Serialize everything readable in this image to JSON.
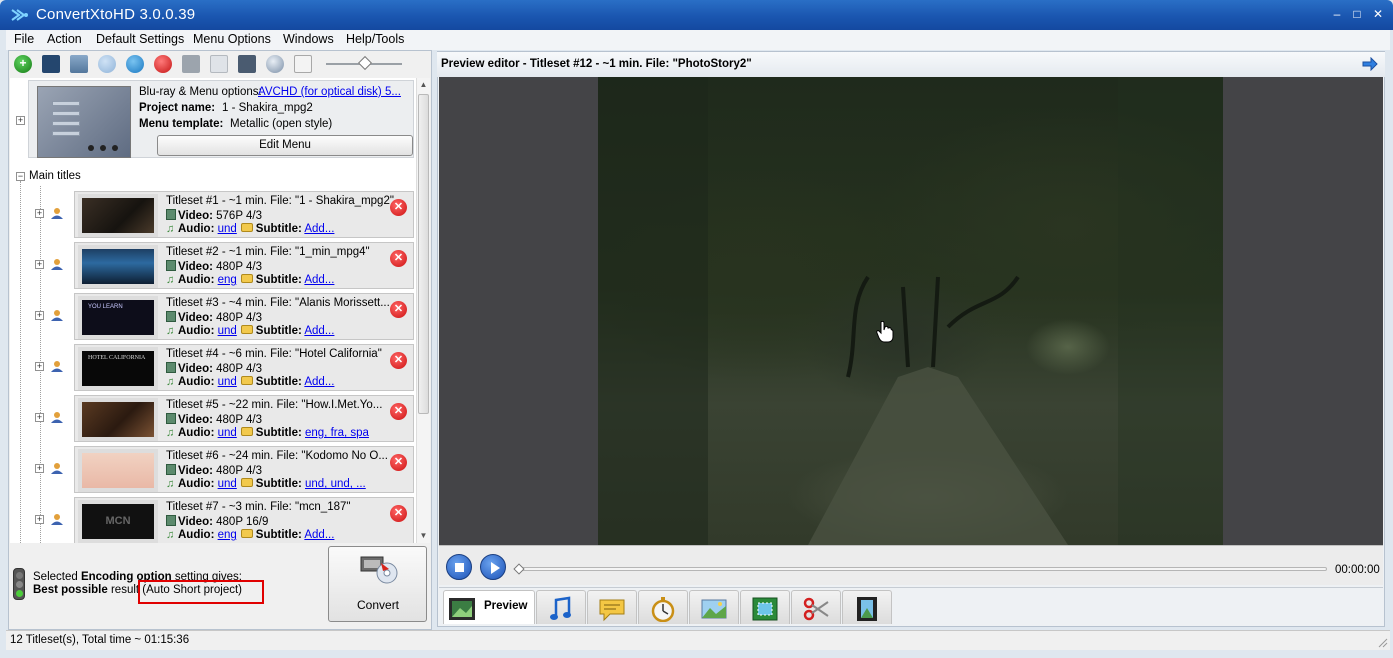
{
  "window": {
    "title": "ConvertXtoHD 3.0.0.39"
  },
  "menu": [
    "File",
    "Action",
    "Default Settings",
    "Menu Options",
    "Windows",
    "Help/Tools"
  ],
  "project": {
    "bluray_label": "Blu-ray & Menu options:",
    "bluray_value": "AVCHD (for optical disk) 5...",
    "name_label": "Project name:",
    "name_value": "1 - Shakira_mpg2",
    "template_label": "Menu template:",
    "template_value": "Metallic (open style)",
    "edit_menu": "Edit Menu"
  },
  "tree": {
    "main_titles": "Main titles"
  },
  "labels": {
    "video": "Video:",
    "audio": "Audio:",
    "subtitle": "Subtitle:"
  },
  "titlesets": [
    {
      "title": "Titleset #1 - ~1 min. File: \"1 - Shakira_mpg2\"",
      "video": "576P 4/3",
      "audio": "und",
      "subtitle": "Add..."
    },
    {
      "title": "Titleset #2 - ~1 min. File: \"1_min_mpg4\"",
      "video": "480P 4/3",
      "audio": "eng",
      "subtitle": "Add..."
    },
    {
      "title": "Titleset #3 - ~4 min. File: \"Alanis Morissett...",
      "video": "480P 4/3",
      "audio": "und",
      "subtitle": "Add..."
    },
    {
      "title": "Titleset #4 - ~6 min. File: \"Hotel California\"",
      "video": "480P 4/3",
      "audio": "und",
      "subtitle": "Add..."
    },
    {
      "title": "Titleset #5 - ~22 min. File: \"How.I.Met.Yo...",
      "video": "480P 4/3",
      "audio": "und",
      "subtitle": "eng, fra, spa"
    },
    {
      "title": "Titleset #6 - ~24 min. File: \"Kodomo No O...",
      "video": "480P 4/3",
      "audio": "und",
      "subtitle": "und, und, ..."
    },
    {
      "title": "Titleset #7 - ~3 min. File: \"mcn_187\"",
      "video": "480P 16/9",
      "audio": "eng",
      "subtitle": "Add..."
    }
  ],
  "thumb_texts": {
    "ts3": "YOU LEARN",
    "ts4": "HOTEL CALIFORNIA",
    "ts7": "MCN"
  },
  "encoding": {
    "line1_prefix": "Selected ",
    "line1_bold": "Encoding option",
    "line1_suffix": " setting gives:",
    "line2_bold": "Best possible",
    "line2_mid": " result ",
    "line2_highlight": "(Auto Short project)"
  },
  "convert_label": "Convert",
  "status": "12 Titleset(s), Total time ~ 01:15:36",
  "preview": {
    "header": "Preview editor - Titleset #12 - ~1 min. File: \"PhotoStory2\"",
    "time": "00:00:00",
    "active_tab": "Preview"
  },
  "tab_icons": [
    "preview-icon",
    "music-icon",
    "subtitle-icon",
    "chapters-stopwatch-icon",
    "picture-icon",
    "crop-icon",
    "cut-scissors-icon",
    "film-icon"
  ]
}
